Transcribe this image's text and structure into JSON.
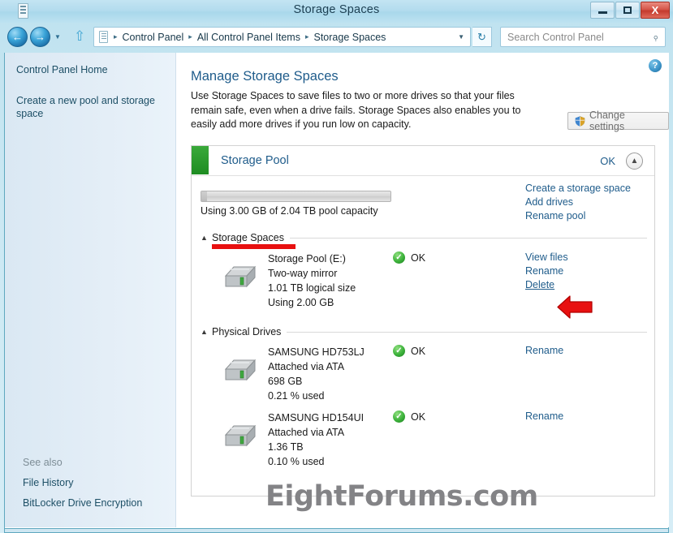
{
  "window": {
    "title": "Storage Spaces",
    "minimize_label": "Minimize",
    "maximize_label": "Maximize",
    "close_label": "X"
  },
  "nav": {
    "back_glyph": "←",
    "forward_glyph": "→",
    "recent_caret": "▼",
    "up_glyph": "⇧",
    "breadcrumbs": [
      "Control Panel",
      "All Control Panel Items",
      "Storage Spaces"
    ],
    "breadcrumb_sep": "▸",
    "address_caret": "▼",
    "refresh_glyph": "↻"
  },
  "search": {
    "placeholder": "Search Control Panel",
    "icon": "search-icon",
    "glyph": "⌕"
  },
  "sidebar": {
    "home_label": "Control Panel Home",
    "create_label": "Create a new pool and storage space",
    "see_also_label": "See also",
    "see_also_items": [
      "File History",
      "BitLocker Drive Encryption"
    ]
  },
  "main": {
    "help_glyph": "?",
    "page_title": "Manage Storage Spaces",
    "description": "Use Storage Spaces to save files to two or more drives so that your files remain safe, even when a drive fails. Storage Spaces also enables you to easily add more drives if you run low on capacity.",
    "change_settings_label": "Change settings"
  },
  "pool": {
    "title": "Storage Pool",
    "status": "OK",
    "status_color": "#1e8c22",
    "collapse_glyph": "▲",
    "usage_label": "Using 3.00 GB of 2.04 TB pool capacity",
    "usage_percent": 0.15,
    "links": [
      "Create a storage space",
      "Add drives",
      "Rename pool"
    ]
  },
  "groups": {
    "storage_spaces": {
      "label": "Storage Spaces",
      "chevron": "▲",
      "highlighted": true,
      "highlight_color": "#e81010"
    },
    "physical_drives": {
      "label": "Physical Drives",
      "chevron": "▲"
    }
  },
  "storage_spaces": [
    {
      "name": "Storage Pool (E:)",
      "resiliency": "Two-way mirror",
      "size": "1.01 TB logical size",
      "used": "Using 2.00 GB",
      "status": "OK",
      "status_icon": "check-circle-icon",
      "links": [
        {
          "label": "View files",
          "underlined": false
        },
        {
          "label": "Rename",
          "underlined": false
        },
        {
          "label": "Delete",
          "underlined": true
        }
      ]
    }
  ],
  "physical_drives": [
    {
      "name": "SAMSUNG HD753LJ",
      "attachment": "Attached via ATA",
      "capacity": "698 GB",
      "used": "0.21 % used",
      "status": "OK",
      "status_icon": "check-circle-icon",
      "links": [
        {
          "label": "Rename",
          "underlined": false
        }
      ]
    },
    {
      "name": "SAMSUNG HD154UI",
      "attachment": "Attached via ATA",
      "capacity": "1.36 TB",
      "used": "0.10 % used",
      "status": "OK",
      "status_icon": "check-circle-icon",
      "links": [
        {
          "label": "Rename",
          "underlined": false
        }
      ]
    }
  ],
  "annotation": {
    "arrow_color": "#e81010",
    "arrow_target": "Delete"
  },
  "watermark": {
    "text": "EightForums.com"
  }
}
